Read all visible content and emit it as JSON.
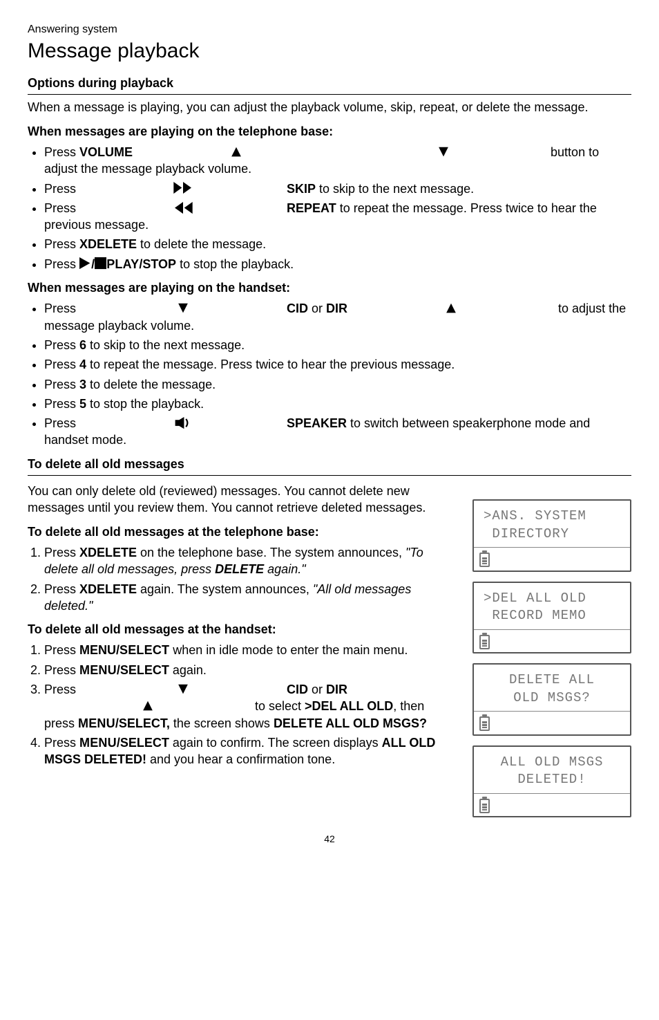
{
  "breadcrumb": "Answering system",
  "page_title": "Message playback",
  "s1": {
    "heading": "Options during playback",
    "intro": "When a message is playing, you can adjust the playback volume, skip, repeat, or delete the message.",
    "base_heading": "When messages are playing on the telephone base:",
    "base": {
      "b1a": "Press ",
      "b1_vol": "VOLUME",
      "b1b": " button to adjust the message playback volume.",
      "b2a": "Press ",
      "b2_skip": "SKIP",
      "b2b": " to skip to the next message.",
      "b3a": "Press ",
      "b3_rep": "REPEAT",
      "b3b": " to repeat the message. Press twice to hear the previous message.",
      "b4a": "Press ",
      "b4_del": "XDELETE",
      "b4b": " to delete the message.",
      "b5a": "Press ",
      "b5_play": "PLAY",
      "b5_stop": "/STOP",
      "b5b": " to stop the playback."
    },
    "hand_heading": "When messages are playing on the handset:",
    "hand": {
      "h1a": "Press ",
      "h1_cid": "CID",
      "h1_mid": " or ",
      "h1_dir": "DIR",
      "h1b": " to adjust the message playback volume.",
      "h2a": "Press ",
      "h2_k": "6",
      "h2b": " to skip to the next message.",
      "h3a": "Press ",
      "h3_k": "4",
      "h3b": " to repeat the message. Press twice to hear the previous message.",
      "h4a": "Press ",
      "h4_k": "3",
      "h4b": " to delete the message.",
      "h5a": "Press ",
      "h5_k": "5",
      "h5b": " to stop the playback.",
      "h6a": "Press ",
      "h6_spk": "SPEAKER",
      "h6b": " to switch between speakerphone mode and handset mode."
    }
  },
  "s2": {
    "heading": "To delete all old messages",
    "intro": "You can only delete old (reviewed) messages. You cannot delete new messages until you review them. You cannot retrieve deleted messages.",
    "base_heading": "To delete all old messages at the telephone base:",
    "base_steps": {
      "1a": "Press ",
      "1_del": "XDELETE",
      "1b": " on the telephone base. The system announces, ",
      "1_q1": "\"To delete all old messages, press ",
      "1_q_del": "DELETE",
      "1_q2": " again.\"",
      "2a": "Press ",
      "2_del": "XDELETE",
      "2b": " again. The system announces, ",
      "2_q": "\"All old messages deleted.\""
    },
    "hand_heading": "To delete all old messages at the handset:",
    "hand_steps": {
      "1a": "Press ",
      "1_menu1": "MENU/",
      "1_menu2": "SELECT",
      "1b": " when in idle mode to enter the main menu.",
      "2a": "Press ",
      "2_menu1": "MENU",
      "2_menu2": "/SELECT",
      "2b": " again.",
      "3a": "Press ",
      "3_cid": "CID",
      "3_mid": " or ",
      "3_dir": "DIR",
      "3b": " to select ",
      "3_opt": ">DEL ALL OLD",
      "3c": ", then press ",
      "3_menu1": "MENU",
      "3_menu2": "/SELECT,",
      "3d": " the screen shows ",
      "3_scr": "DELETE ALL OLD MSGS?",
      "4a": "Press ",
      "4_menu1": "MENU",
      "4_menu2": "/SELECT",
      "4b": " again to confirm. The screen displays ",
      "4_scr": "ALL OLD MSGS DELETED!",
      "4c": " and you hear a confirmation tone."
    }
  },
  "lcd": {
    "s1l1": ">ANS. SYSTEM",
    "s1l2": " DIRECTORY",
    "s2l1": ">DEL ALL OLD",
    "s2l2": " RECORD MEMO",
    "s3l1": "DELETE ALL",
    "s3l2": "OLD MSGS?",
    "s4l1": "ALL OLD MSGS",
    "s4l2": "DELETED!"
  },
  "page_number": "42"
}
